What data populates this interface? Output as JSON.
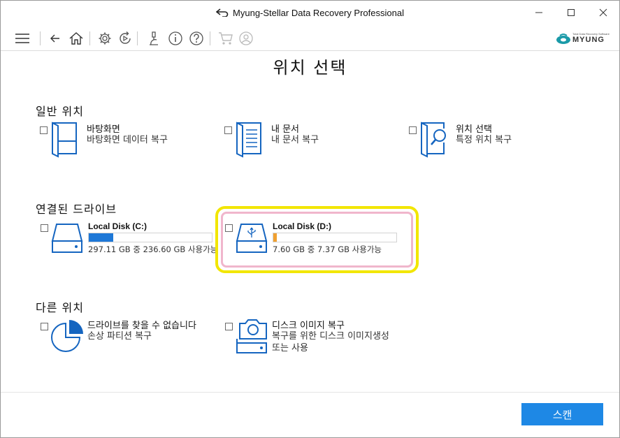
{
  "window": {
    "title": "Myung-Stellar Data Recovery Professional",
    "controls": {
      "minimize": "—",
      "maximize": "☐",
      "close": "✕"
    }
  },
  "toolbar": {
    "icons": [
      "menu-icon",
      "back-icon",
      "home-icon",
      "settings-icon",
      "update-icon",
      "clean-icon",
      "info-icon",
      "help-icon",
      "cart-icon",
      "account-icon"
    ],
    "brand_tagline": "Total Data Recovery Software",
    "brand_name": "MYUNG"
  },
  "page": {
    "title": "위치 선택"
  },
  "sections": {
    "common": {
      "title": "일반 위치",
      "items": [
        {
          "name": "바탕화면",
          "desc": "바탕화면 데이터 복구",
          "icon": "desktop-icon"
        },
        {
          "name": "내 문서",
          "desc": "내 문서 복구",
          "icon": "documents-icon"
        },
        {
          "name": "위치 선택",
          "desc": "특정 위치 복구",
          "icon": "folder-search-icon"
        }
      ]
    },
    "drives": {
      "title": "연결된 드라이브",
      "items": [
        {
          "name": "Local Disk (C:)",
          "info": "297.11 GB 중 236.60 GB 사용가능",
          "used_fraction": 0.2,
          "bar_color": "#1e78d7",
          "icon": "hard-drive-icon"
        },
        {
          "name": "Local Disk (D:)",
          "info": "7.60 GB 중 7.37 GB 사용가능",
          "used_fraction": 0.03,
          "bar_color": "#f0a030",
          "icon": "usb-drive-icon"
        }
      ]
    },
    "other": {
      "title": "다른 위치",
      "items": [
        {
          "name": "드라이브를 찾을 수 없습니다",
          "desc": "손상 파티션 복구",
          "icon": "partition-pie-icon"
        },
        {
          "name": "디스크 이미지 복구",
          "desc": "복구를 위한 디스크 이미지생성",
          "desc2": "또는 사용",
          "icon": "disk-image-icon"
        }
      ]
    }
  },
  "colors": {
    "accent": "#1e88e5",
    "icon_blue": "#1565c0",
    "highlight_outer": "#f2e600",
    "highlight_inner": "#f0b6cc"
  },
  "buttons": {
    "scan": "스캔"
  }
}
